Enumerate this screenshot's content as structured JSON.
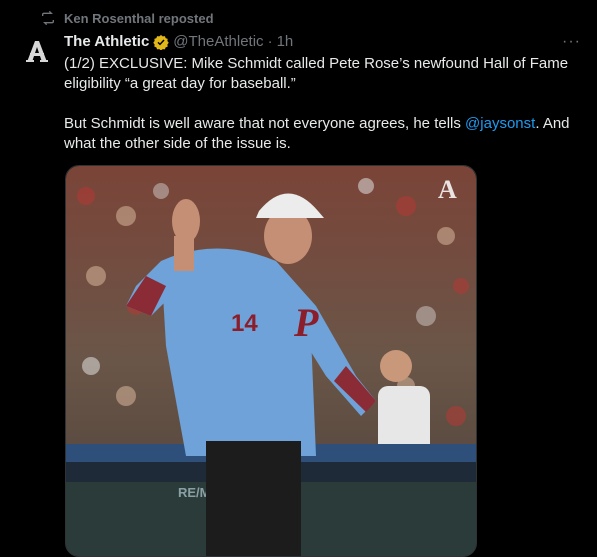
{
  "repost": {
    "text": "Ken Rosenthal reposted",
    "icon": "repost-icon"
  },
  "author": {
    "name": "The Athletic",
    "handle": "@TheAthletic",
    "separator": "·",
    "time": "1h",
    "avatar_letter": "A"
  },
  "more_label": "···",
  "tweet": {
    "line1": "(1/2) EXCLUSIVE: Mike Schmidt called Pete Rose’s newfound Hall of Fame eligibility “a great day for baseball.”",
    "line2_before": "But Schmidt is well aware that not everyone agrees, he tells ",
    "mention": "@jaysonst",
    "line2_after": ". And what the other side of the issue is."
  },
  "photo": {
    "jersey_number": "14",
    "jersey_logo": "P",
    "watermark": "A",
    "signage": "RE/MA"
  },
  "colors": {
    "background": "#000000",
    "text": "#e7e9ea",
    "secondary": "#71767b",
    "link": "#1d9bf0",
    "verified": "#e2b719"
  }
}
